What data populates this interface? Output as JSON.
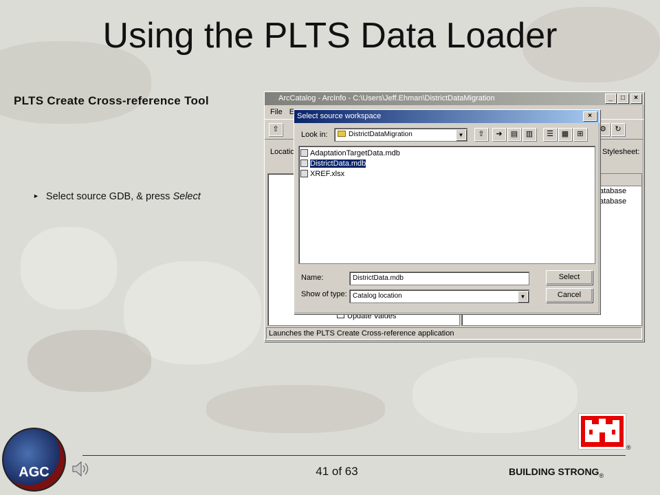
{
  "slide": {
    "title": "Using the PLTS Data Loader",
    "subtitle": "PLTS Create Cross-reference Tool",
    "bullet_prefix": "Select source GDB, & press ",
    "bullet_emphasis": "Select",
    "page": "41 of 63",
    "brand": "BUILDING STRONG",
    "registered": "®",
    "logo_text": "AGC"
  },
  "arccatalog": {
    "title": "ArcCatalog - ArcInfo - C:\\Users\\Jeff.Ehman\\DistrictDataMigration",
    "menu": [
      "File",
      "E"
    ],
    "location_label": "Locatio",
    "stylesheet_label": "Stylesheet:",
    "right_items": [
      "atabase",
      "atabase"
    ],
    "tree_item": "Update Values",
    "status": "Launches the PLTS Create Cross-reference application"
  },
  "dialog": {
    "title": "Select source workspace",
    "look_in_label": "Look in:",
    "look_in_value": "DistrictDataMigration",
    "files": [
      {
        "name": "AdaptationTargetData.mdb",
        "selected": false
      },
      {
        "name": "DistrictData.mdb",
        "selected": true
      },
      {
        "name": "XREF.xlsx",
        "selected": false
      }
    ],
    "name_label": "Name:",
    "name_value": "DistrictData.mdb",
    "type_label": "Show of type:",
    "type_value": "Catalog location",
    "select_button": "Select",
    "cancel_button": "Cancel"
  },
  "colors": {
    "active_title": "#0a246a",
    "window_face": "#d4d0c8",
    "usace_red": "#e60000"
  }
}
